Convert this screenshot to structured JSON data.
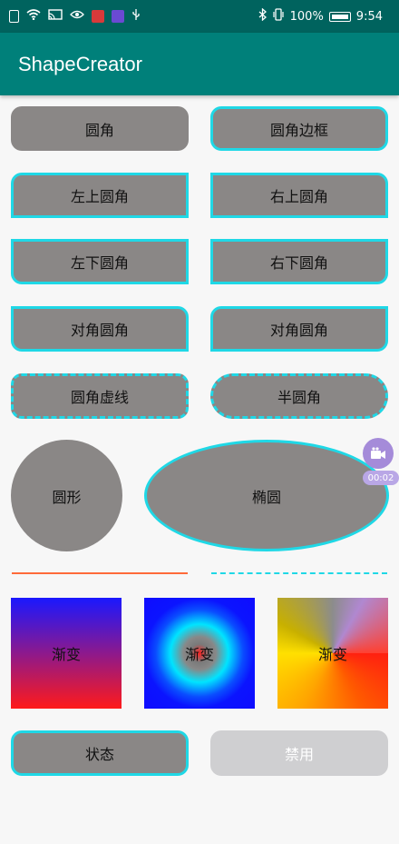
{
  "status": {
    "battery": "100%",
    "time": "9:54"
  },
  "app": {
    "title": "ShapeCreator"
  },
  "shapes": {
    "rounded": "圆角",
    "rounded_border": "圆角边框",
    "top_left": "左上圆角",
    "top_right": "右上圆角",
    "bottom_left": "左下圆角",
    "bottom_right": "右下圆角",
    "diagonal_1": "对角圆角",
    "diagonal_2": "对角圆角",
    "dashed_rounded": "圆角虚线",
    "semicircle": "半圆角",
    "circle": "圆形",
    "ellipse": "椭圆"
  },
  "gradients": {
    "linear": "渐变",
    "radial": "渐变",
    "sweep": "渐变"
  },
  "buttons": {
    "state": "状态",
    "disabled": "禁用"
  },
  "floating": {
    "time": "00:02"
  },
  "colors": {
    "status_bar": "#00635e",
    "app_bar": "#00807a",
    "shape_fill": "#8a8786",
    "border": "#1fd8e6",
    "line_solid": "#ff6a3a",
    "disabled_fill": "#cfcfd1"
  }
}
